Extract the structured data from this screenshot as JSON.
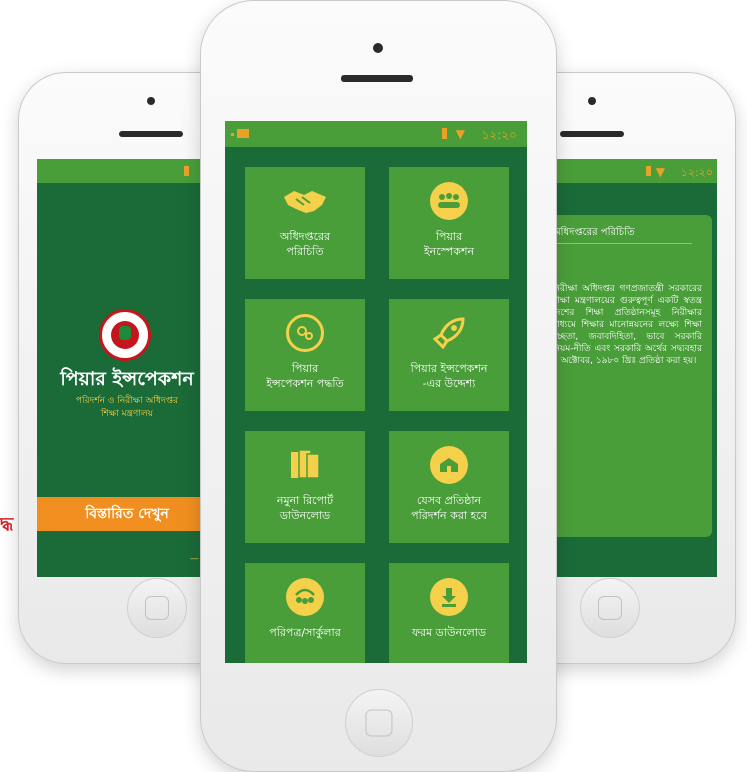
{
  "colors": {
    "dark_green": "#1b6b38",
    "tile_green": "#4a9e3a",
    "accent_yellow": "#f5d04a",
    "accent_orange": "#f08f1f",
    "status_orange": "#e8a227",
    "seal_red": "#c4161c"
  },
  "status_bar": {
    "time": "১২:২০"
  },
  "left_screen": {
    "title": "পিয়ার ইন্সপেকশন",
    "subtitle": "পরিদর্শন ও নিরীক্ষা অধিদপ্তর\nশিক্ষা মন্ত্রণালয়",
    "details_button": "বিস্তারিত দেখুন",
    "side_fragment": "দ্ধ"
  },
  "menu": {
    "tiles": [
      {
        "label": "অধিদপ্তরের\nপরিচিতি",
        "icon": "handshake-icon"
      },
      {
        "label": "পিয়ার\nইনস্পেকশন",
        "icon": "group-icon"
      },
      {
        "label": "পিয়ার\nইন্সপেকশন পদ্ধতি",
        "icon": "gears-icon"
      },
      {
        "label": "পিয়ার ইন্সপেকশন\n-এর উদ্দেশ্য",
        "icon": "rocket-icon"
      },
      {
        "label": "নমুনা রিপোর্ট\nডাউনলোড",
        "icon": "files-icon"
      },
      {
        "label": "যেসব প্রতিষ্ঠান\nপরিদর্শন করা হবে",
        "icon": "building-icon"
      },
      {
        "label": "পরিপত্র/সার্কুলার",
        "icon": "people-share-icon"
      },
      {
        "label": "ফরম ডাউনলোড",
        "icon": "download-icon"
      }
    ]
  },
  "right_screen": {
    "about_title": "অধিদপ্তরের পরিচিতি",
    "about_body": "নিরীক্ষা অধিদপ্তর গণপ্রজাতন্ত্রী সরকারের শিক্ষা মন্ত্রণালয়ের গুরুত্বপূর্ণ একটি স্বতন্ত্র দেশের শিক্ষা প্রতিষ্ঠানসমূহ নিরীক্ষার মাধ্যমে শিক্ষার মানোন্নয়নের লক্ষ্যে শিক্ষা স্বচ্ছতা, জবাবদিহিতা, ভাবে সরকারি নিয়ম-নীতি এবং সরকারি অর্থের সদ্ব্যবহার ১ অক্টোবর, ১৯৮০ খ্রিঃ প্রতিষ্ঠা করা হয়।"
  }
}
